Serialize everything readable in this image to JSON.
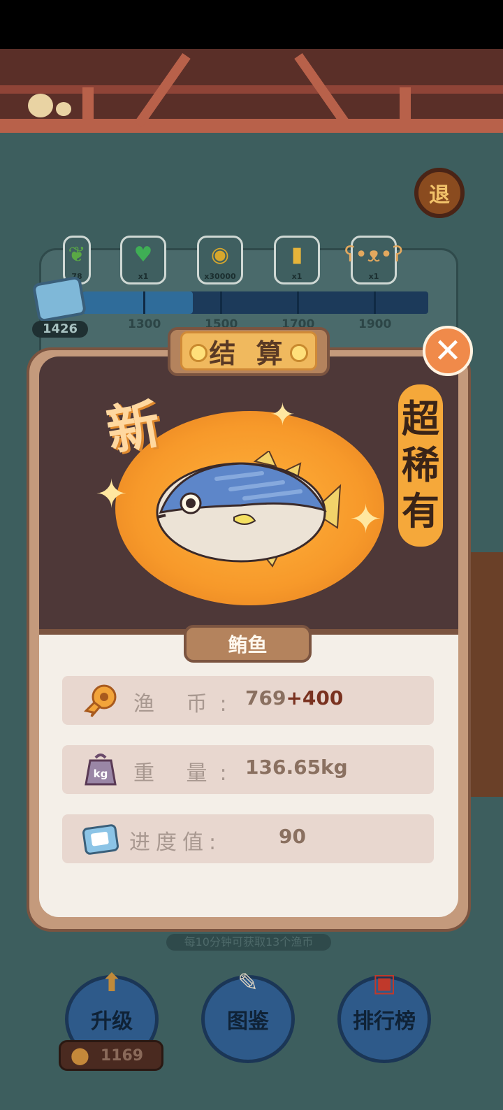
{
  "header": {
    "exit_label": "退"
  },
  "progress": {
    "current_score": "1426",
    "fill_fraction": 0.32,
    "ticks": [
      "1300",
      "1500",
      "1700",
      "1900"
    ],
    "rewards": [
      {
        "icon": "leaf-icon",
        "qty": "78"
      },
      {
        "icon": "heart-icon",
        "qty": "x1"
      },
      {
        "icon": "coin-icon",
        "qty": "x30000"
      },
      {
        "icon": "ticket-icon",
        "qty": "x1"
      },
      {
        "icon": "bear-icon",
        "qty": "x1"
      }
    ]
  },
  "modal": {
    "title": "结 算",
    "new_badge": "新",
    "rarity": [
      "超",
      "稀",
      "有"
    ],
    "fish_name": "鲔鱼",
    "stats": [
      {
        "icon": "fish-coin-icon",
        "label": "渔 币:",
        "base": "769",
        "bonus": "+400"
      },
      {
        "icon": "weight-icon",
        "label": "重 量:",
        "base": "136.65kg",
        "bonus": ""
      },
      {
        "icon": "progress-card-icon",
        "label": "进度值:",
        "base": "90",
        "bonus": ""
      }
    ]
  },
  "hint_text": "每10分钟可获取13个渔币",
  "bottom_nav": {
    "upgrade_label": "升级",
    "guide_label": "图鉴",
    "rank_label": "排行榜",
    "coins": "1169"
  },
  "colors": {
    "accent_orange": "#f5a83a",
    "panel_brown": "#c49a7c",
    "bonus_text": "#7a3220"
  }
}
